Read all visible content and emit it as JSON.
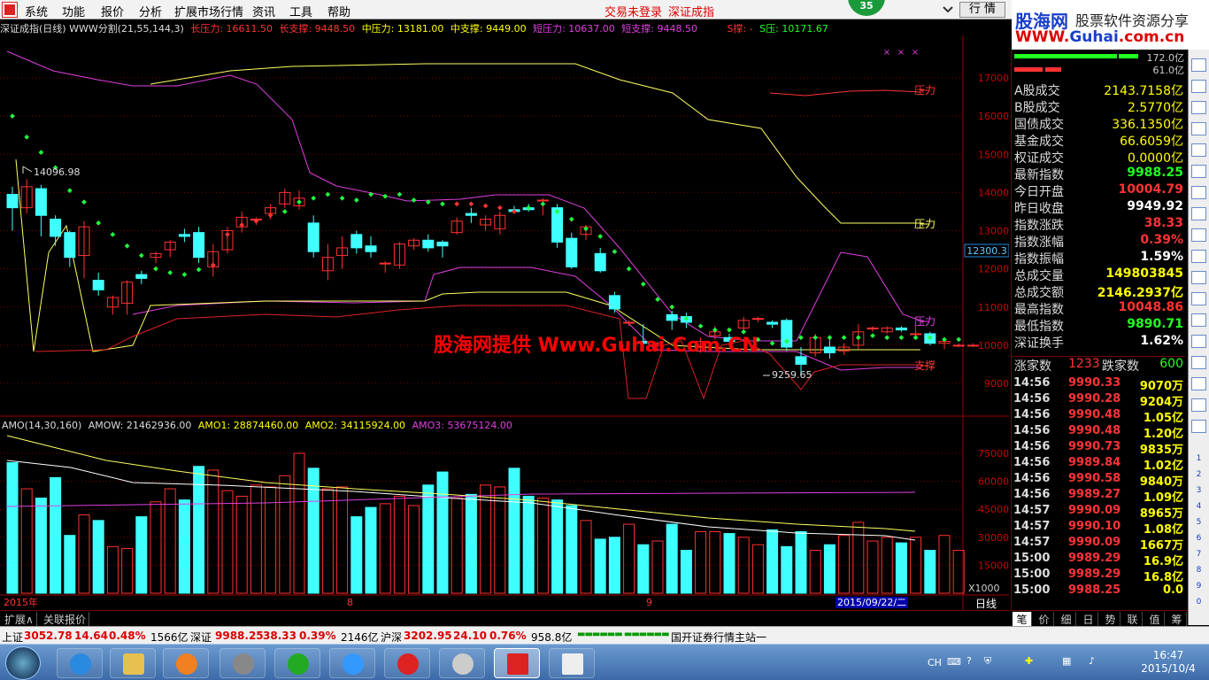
{
  "menu": [
    "系统",
    "功能",
    "报价",
    "分析",
    "扩展市场行情",
    "资讯",
    "工具",
    "帮助"
  ],
  "notice1": "交易未登录",
  "notice2": "深证成指",
  "badge": "35",
  "quote_btn": "行 情",
  "brand": {
    "name": "股海网",
    "slogan": "股票软件资源分享",
    "url_a": "WWW.",
    "url_b": "Guhai",
    "url_c": ".com.cn"
  },
  "info": {
    "title": "深证成指(日线) WWW分割(21,55,144,3)",
    "long_press": "长压力: 16611.50",
    "long_support": "长支撑: 9448.50",
    "mid_press": "中压力: 13181.00",
    "mid_support": "中支撑: 9449.00",
    "short_press": "短压力: 10637.00",
    "short_support": "短支撑: 9448.50",
    "s_up": "S撑: -",
    "s_press": "S压: 10171.67"
  },
  "watermark": "股海网提供 Www.Guhai.Com.CN",
  "chart_labels": {
    "high": "14096.98",
    "low": "9259.65",
    "yaxis_cur": "12300.3",
    "lbl_press": "压力",
    "lbl_support": "支撑",
    "x_unit": "X1000",
    "x_year": "2015年",
    "x_m8": "8",
    "x_m9": "9",
    "x_date": "2015/09/22/二",
    "period": "日线"
  },
  "amo": {
    "title": "AMO(14,30,160)",
    "amow": "AMOW: 21462936.00",
    "amo1": "AMO1: 28874460.00",
    "amo2": "AMO2: 34115924.00",
    "amo3": "AMO3: 53675124.00"
  },
  "tabs": [
    "扩展∧",
    "关联报价"
  ],
  "colors": {
    "up": "#ff3030",
    "down": "#40ffff",
    "ma_yellow": "#ffff60",
    "ma_magenta": "#e040e0",
    "dot_green": "#20ff40"
  },
  "chart_data": {
    "type": "candlestick",
    "title": "深证成指(日线)",
    "y_ticks": [
      17000,
      16000,
      15000,
      14000,
      13000,
      12000,
      11000,
      10000,
      9000
    ],
    "candles": [
      [
        13950,
        13600,
        14150,
        13000
      ],
      [
        13600,
        14150,
        14350,
        13450
      ],
      [
        14100,
        13400,
        14200,
        12850
      ],
      [
        13300,
        12850,
        13400,
        12600
      ],
      [
        12950,
        12300,
        13000,
        12050
      ],
      [
        12350,
        13100,
        13250,
        11750
      ],
      [
        11700,
        11450,
        11900,
        11300
      ],
      [
        11000,
        11250,
        11300,
        10800
      ],
      [
        11100,
        11650,
        11700,
        10800
      ],
      [
        11850,
        11750,
        11950,
        11600
      ],
      [
        12300,
        12400,
        12450,
        12150
      ],
      [
        12500,
        12700,
        12750,
        12300
      ],
      [
        12900,
        12850,
        13050,
        12700
      ],
      [
        12950,
        12300,
        13100,
        12150
      ],
      [
        12050,
        12450,
        12650,
        11800
      ],
      [
        12500,
        13000,
        13100,
        12400
      ],
      [
        13100,
        13350,
        13500,
        12950
      ],
      [
        13300,
        13300,
        13350,
        13150
      ],
      [
        13450,
        13600,
        13700,
        13300
      ],
      [
        13700,
        14000,
        14100,
        13600
      ],
      [
        13650,
        13850,
        14050,
        13550
      ],
      [
        13200,
        12450,
        13400,
        12300
      ],
      [
        11950,
        12300,
        12650,
        11700
      ],
      [
        12350,
        12550,
        12850,
        12000
      ],
      [
        12900,
        12550,
        13000,
        12400
      ],
      [
        12600,
        12450,
        12850,
        12300
      ],
      [
        12150,
        12150,
        12200,
        11900
      ],
      [
        12100,
        12650,
        12700,
        12000
      ],
      [
        12600,
        12750,
        12800,
        12500
      ],
      [
        12750,
        12550,
        12900,
        12450
      ],
      [
        12700,
        12600,
        12750,
        12300
      ],
      [
        12950,
        13250,
        13350,
        12900
      ],
      [
        13450,
        13400,
        13600,
        13200
      ],
      [
        13150,
        13300,
        13400,
        13000
      ],
      [
        13050,
        13400,
        13500,
        12900
      ],
      [
        13550,
        13500,
        13650,
        13450
      ],
      [
        13600,
        13550,
        13700,
        13500
      ],
      [
        13800,
        13800,
        13850,
        13400
      ],
      [
        13600,
        12700,
        13700,
        12550
      ],
      [
        12800,
        12050,
        12950,
        12000
      ],
      [
        12900,
        13100,
        13150,
        12750
      ],
      [
        12400,
        11950,
        12550,
        11900
      ],
      [
        11300,
        10950,
        11400,
        10850
      ],
      [
        10600,
        10600,
        10650,
        10500
      ],
      [
        10100,
        10050,
        10550,
        9850
      ],
      [
        10000,
        10050,
        10100,
        9850
      ],
      [
        10800,
        10650,
        10900,
        10400
      ],
      [
        10750,
        10600,
        10850,
        10450
      ],
      [
        9850,
        10100,
        10200,
        9800
      ],
      [
        10250,
        10350,
        10500,
        10150
      ],
      [
        10200,
        10100,
        10300,
        10050
      ],
      [
        10450,
        10650,
        10750,
        10300
      ],
      [
        10700,
        10700,
        10750,
        10600
      ],
      [
        10600,
        10550,
        10650,
        10450
      ],
      [
        10650,
        9950,
        10700,
        9850
      ],
      [
        9700,
        9500,
        9950,
        9250
      ],
      [
        9800,
        10200,
        10300,
        9700
      ],
      [
        9950,
        9800,
        10150,
        9650
      ],
      [
        9850,
        9950,
        10050,
        9750
      ],
      [
        10000,
        10350,
        10550,
        9900
      ],
      [
        10450,
        10450,
        10500,
        10350
      ],
      [
        10350,
        10450,
        10500,
        10300
      ],
      [
        10450,
        10400,
        10500,
        10350
      ],
      [
        10300,
        10300,
        10500,
        10200
      ],
      [
        10300,
        10050,
        10350,
        10000
      ],
      [
        10050,
        10100,
        10200,
        9900
      ],
      [
        10000,
        10000,
        10050,
        9950
      ],
      [
        10000,
        10000,
        10050,
        9950
      ]
    ],
    "dots": [
      [
        0,
        16000
      ],
      [
        1,
        15450
      ],
      [
        2,
        15050
      ],
      [
        3,
        14650
      ],
      [
        4,
        14050
      ],
      [
        5,
        13750
      ],
      [
        6,
        13200
      ],
      [
        7,
        12900
      ],
      [
        8,
        12600
      ],
      [
        9,
        12350
      ],
      [
        10,
        12000
      ],
      [
        11,
        11900
      ],
      [
        12,
        11850
      ],
      [
        13,
        11980
      ],
      [
        14,
        12100
      ],
      [
        15,
        12900
      ],
      [
        16,
        13150
      ],
      [
        17,
        13250
      ],
      [
        18,
        13400
      ],
      [
        19,
        13500
      ],
      [
        20,
        13750
      ],
      [
        21,
        13850
      ],
      [
        22,
        13950
      ],
      [
        23,
        13850
      ],
      [
        24,
        13800
      ],
      [
        25,
        13950
      ],
      [
        26,
        13900
      ],
      [
        27,
        13950
      ],
      [
        28,
        13800
      ],
      [
        29,
        13750
      ],
      [
        30,
        13700
      ],
      [
        31,
        13700
      ],
      [
        32,
        13700
      ],
      [
        33,
        13650
      ],
      [
        34,
        13600
      ],
      [
        35,
        13500
      ],
      [
        36,
        13600
      ],
      [
        37,
        13700
      ],
      [
        38,
        13500
      ],
      [
        39,
        13300
      ],
      [
        40,
        13050
      ],
      [
        41,
        12850
      ],
      [
        42,
        12450
      ],
      [
        43,
        12000
      ],
      [
        44,
        11600
      ],
      [
        45,
        11200
      ],
      [
        46,
        11000
      ],
      [
        47,
        10700
      ],
      [
        48,
        10500
      ],
      [
        49,
        10400
      ],
      [
        50,
        10400
      ],
      [
        51,
        10350
      ],
      [
        52,
        10150
      ],
      [
        53,
        10050
      ],
      [
        54,
        10100
      ],
      [
        55,
        10200
      ],
      [
        56,
        10200
      ],
      [
        57,
        10200
      ],
      [
        58,
        10200
      ],
      [
        59,
        10200
      ],
      [
        60,
        10250
      ],
      [
        61,
        10200
      ],
      [
        62,
        10200
      ],
      [
        63,
        10200
      ],
      [
        64,
        10200
      ],
      [
        65,
        10150
      ],
      [
        66,
        10150
      ]
    ],
    "long_press_line": [
      17500,
      17300,
      17000,
      16800,
      16850,
      16800,
      16750,
      16650,
      16600,
      16600
    ],
    "volume_bars": [
      70000,
      56000,
      51000,
      62000,
      31000,
      42000,
      39000,
      25000,
      24000,
      41000,
      49000,
      56000,
      50000,
      68000,
      66000,
      55000,
      52000,
      58000,
      57000,
      63000,
      75000,
      67000,
      56000,
      57000,
      41000,
      46000,
      48000,
      52000,
      47000,
      58000,
      65000,
      51000,
      53000,
      58000,
      57000,
      67000,
      52000,
      51000,
      50000,
      47000,
      39000,
      29000,
      30000,
      37000,
      26000,
      28000,
      37000,
      23000,
      33000,
      33000,
      32000,
      30000,
      26000,
      34000,
      25000,
      33000,
      23000,
      26000,
      31000,
      38000,
      28000,
      30000,
      27000,
      30000,
      23000,
      31000,
      23000
    ],
    "vol_ticks": [
      75000,
      60000,
      45000,
      30000,
      15000
    ]
  },
  "right": {
    "bar1": "172.0亿",
    "bar2": "61.0亿",
    "stats": [
      [
        "A股成交",
        "2143.7158亿",
        "y"
      ],
      [
        "B股成交",
        "2.5770亿",
        "y"
      ],
      [
        "国债成交",
        "336.1350亿",
        "y"
      ],
      [
        "基金成交",
        "66.6059亿",
        "y"
      ],
      [
        "权证成交",
        "0.0000亿",
        "y"
      ],
      [
        "最新指数",
        "9988.25",
        "g"
      ],
      [
        "今日开盘",
        "10004.79",
        "r"
      ],
      [
        "昨日收盘",
        "9949.92",
        "w"
      ],
      [
        "指数涨跌",
        "38.33",
        "r"
      ],
      [
        "指数涨幅",
        "0.39%",
        "r"
      ],
      [
        "指数振幅",
        "1.59%",
        "w"
      ],
      [
        "总成交量",
        "149803845",
        "y"
      ],
      [
        "总成交额",
        "2146.2937亿",
        "y"
      ],
      [
        "最高指数",
        "10048.86",
        "r"
      ],
      [
        "最低指数",
        "9890.71",
        "g"
      ],
      [
        "深证换手",
        "1.62%",
        "w"
      ]
    ],
    "up_label": "涨家数",
    "up_count": "1233",
    "down_label": "跌家数",
    "down_count": "600",
    "trades": [
      [
        "14:56",
        "9990.33",
        "9070万"
      ],
      [
        "14:56",
        "9990.28",
        "9204万"
      ],
      [
        "14:56",
        "9990.48",
        "1.05亿"
      ],
      [
        "14:56",
        "9990.48",
        "1.20亿"
      ],
      [
        "14:56",
        "9990.73",
        "9835万"
      ],
      [
        "14:56",
        "9989.84",
        "1.02亿"
      ],
      [
        "14:56",
        "9990.58",
        "9840万"
      ],
      [
        "14:56",
        "9989.27",
        "1.09亿"
      ],
      [
        "14:57",
        "9990.09",
        "8965万"
      ],
      [
        "14:57",
        "9990.10",
        "1.08亿"
      ],
      [
        "14:57",
        "9990.09",
        "1667万"
      ],
      [
        "15:00",
        "9989.29",
        "16.9亿"
      ],
      [
        "15:00",
        "9989.29",
        "16.8亿"
      ],
      [
        "15:00",
        "9988.25",
        "0.0"
      ]
    ],
    "tabs": [
      "笔",
      "价",
      "细",
      "日",
      "势",
      "联",
      "值",
      "筹"
    ]
  },
  "sidetool_nums": [
    "1",
    "2",
    "3",
    "4",
    "5",
    "6",
    "7",
    "8",
    "9",
    "0"
  ],
  "status": {
    "sh_label": "上证",
    "sh_val": "3052.78",
    "sh_chg": "14.64",
    "sh_pct": "0.48%",
    "sh_amt": "1566亿",
    "sz_label": "深证",
    "sz_val": "9988.25",
    "sz_chg": "38.33",
    "sz_pct": "0.39%",
    "sz_amt": "2146亿",
    "hs_label": "沪深",
    "hs_val": "3202.95",
    "hs_chg": "24.10",
    "hs_pct": "0.76%",
    "hs_amt": "958.8亿",
    "server": "国开证券行情主站一"
  },
  "taskbar": {
    "time": "16:47",
    "date": "2015/10/4",
    "lang": "CH"
  }
}
